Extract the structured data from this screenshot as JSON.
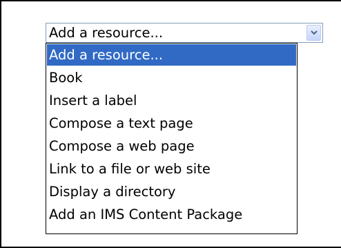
{
  "select": {
    "value": "Add a resource...",
    "dropdown_icon": "chevron-down-icon",
    "options": [
      "Add a resource...",
      "Book",
      "Insert a label",
      "Compose a text page",
      "Compose a web page",
      "Link to a file or web site",
      "Display a directory",
      "Add an IMS Content Package"
    ],
    "selected_index": 0
  },
  "colors": {
    "highlight": "#316ac5",
    "highlight_text": "#ffffff",
    "field_border": "#7f9db9",
    "frame_border": "#000000"
  }
}
